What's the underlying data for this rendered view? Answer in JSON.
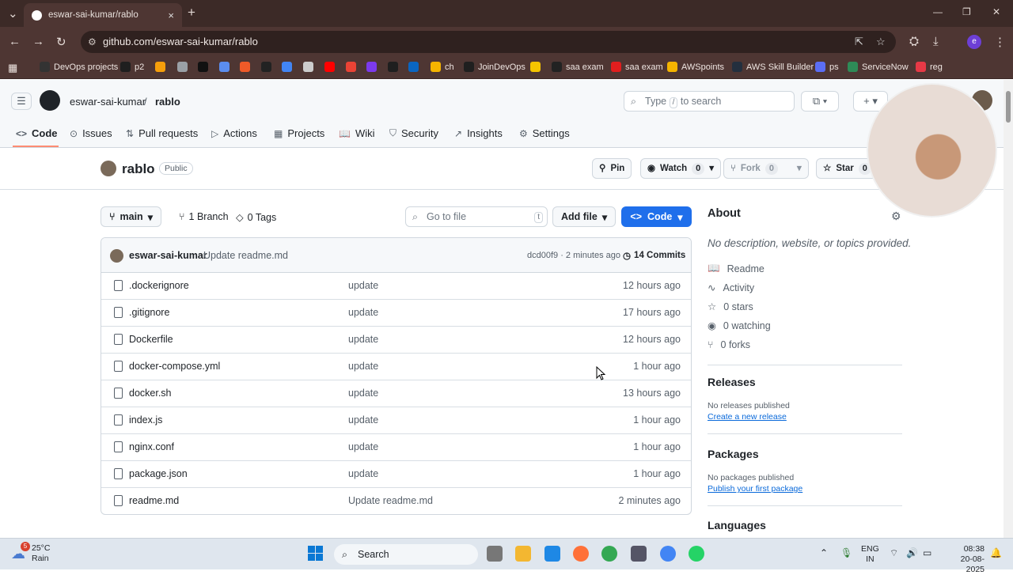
{
  "browser": {
    "tab_title": "eswar-sai-kumar/rablo",
    "tab_close": "×",
    "new_tab": "+",
    "tab_menu": "⌄",
    "url": "github.com/eswar-sai-kumar/rablo",
    "win_min": "—",
    "win_max": "❐",
    "win_close": "✕",
    "bookmarks": [
      {
        "label": "DevOps projects",
        "color": "#333333"
      },
      {
        "label": "p2",
        "color": "#1f1f1f"
      },
      {
        "label": "",
        "color": "#f59e0b"
      },
      {
        "label": "",
        "color": "#9aa0a6"
      },
      {
        "label": "",
        "color": "#111111"
      },
      {
        "label": "",
        "color": "#5b8def"
      },
      {
        "label": "",
        "color": "#f05a28"
      },
      {
        "label": "",
        "color": "#222222"
      },
      {
        "label": "",
        "color": "#4285f4"
      },
      {
        "label": "",
        "color": "#cccccc"
      },
      {
        "label": "",
        "color": "#ff0000"
      },
      {
        "label": "",
        "color": "#ea4335"
      },
      {
        "label": "",
        "color": "#7c3aed"
      },
      {
        "label": "",
        "color": "#1f1f1f"
      },
      {
        "label": "",
        "color": "#0a66c2"
      },
      {
        "label": "ch",
        "color": "#f5b400"
      },
      {
        "label": "JoinDevOps",
        "color": "#1f1f1f"
      },
      {
        "label": "",
        "color": "#f5c400"
      },
      {
        "label": "saa exam",
        "color": "#222222"
      },
      {
        "label": "saa exam",
        "color": "#e01e1e"
      },
      {
        "label": "AWSpoints",
        "color": "#f5b400"
      },
      {
        "label": "AWS Skill Builder",
        "color": "#232f3e"
      },
      {
        "label": "ps",
        "color": "#5b6ef5"
      },
      {
        "label": "ServiceNow",
        "color": "#2e8b57"
      },
      {
        "label": "reg",
        "color": "#e63946"
      }
    ]
  },
  "header": {
    "owner": "eswar-sai-kumar",
    "slash": "/",
    "repo": "rablo",
    "search_placeholder_pre": "Type",
    "search_key": "/",
    "search_placeholder_post": "to search",
    "plus": "+ ▾",
    "copilot": "⧉ ▾"
  },
  "nav": [
    {
      "label": "Code",
      "icon": "<>",
      "active": true
    },
    {
      "label": "Issues",
      "icon": "⊙"
    },
    {
      "label": "Pull requests",
      "icon": "⇅"
    },
    {
      "label": "Actions",
      "icon": "▷"
    },
    {
      "label": "Projects",
      "icon": "▦"
    },
    {
      "label": "Wiki",
      "icon": "📖"
    },
    {
      "label": "Security",
      "icon": "⛉"
    },
    {
      "label": "Insights",
      "icon": "↗"
    },
    {
      "label": "Settings",
      "icon": "⚙"
    }
  ],
  "repo": {
    "name": "rablo",
    "visibility": "Public",
    "pin": "Pin",
    "watch": "Watch",
    "watch_count": "0",
    "fork": "Fork",
    "fork_count": "0",
    "star": "Star",
    "star_count": "0"
  },
  "toolbar": {
    "branch": "main",
    "branch_count": "1 Branch",
    "tag_count": "0 Tags",
    "goto_placeholder": "Go to file",
    "goto_key": "t",
    "add_file": "Add file",
    "code": "Code"
  },
  "latest_commit": {
    "author": "eswar-sai-kumar",
    "message": "Update readme.md",
    "sha_time": "dcd00f9 · 2 minutes ago",
    "commits": "14 Commits"
  },
  "files": [
    {
      "name": ".dockerignore",
      "message": "update",
      "time": "12 hours ago"
    },
    {
      "name": ".gitignore",
      "message": "update",
      "time": "17 hours ago"
    },
    {
      "name": "Dockerfile",
      "message": "update",
      "time": "12 hours ago"
    },
    {
      "name": "docker-compose.yml",
      "message": "update",
      "time": "1 hour ago"
    },
    {
      "name": "docker.sh",
      "message": "update",
      "time": "13 hours ago"
    },
    {
      "name": "index.js",
      "message": "update",
      "time": "1 hour ago"
    },
    {
      "name": "nginx.conf",
      "message": "update",
      "time": "1 hour ago"
    },
    {
      "name": "package.json",
      "message": "update",
      "time": "1 hour ago"
    },
    {
      "name": "readme.md",
      "message": "Update readme.md",
      "time": "2 minutes ago"
    }
  ],
  "about": {
    "title": "About",
    "description": "No description, website, or topics provided.",
    "items": [
      {
        "icon": "📖",
        "label": "Readme"
      },
      {
        "icon": "∿",
        "label": "Activity"
      },
      {
        "icon": "☆",
        "label": "0 stars"
      },
      {
        "icon": "◉",
        "label": "0 watching"
      },
      {
        "icon": "⑂",
        "label": "0 forks"
      }
    ]
  },
  "releases": {
    "title": "Releases",
    "status": "No releases published",
    "link": "Create a new release"
  },
  "packages": {
    "title": "Packages",
    "status": "No packages published",
    "link": "Publish your first package"
  },
  "languages": {
    "title": "Languages"
  },
  "taskbar": {
    "weather_temp": "25°C",
    "weather_desc": "Rain",
    "weather_badge": "5",
    "search": "Search",
    "lang_top": "ENG",
    "lang_bottom": "IN",
    "time": "08:38",
    "date": "20-08-2025"
  }
}
